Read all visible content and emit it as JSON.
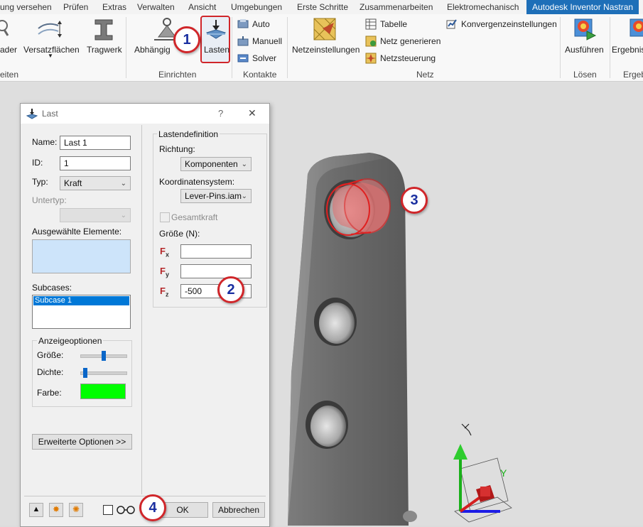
{
  "ribbon_tabs": [
    {
      "label": "ung versehen"
    },
    {
      "label": "Prüfen"
    },
    {
      "label": "Extras"
    },
    {
      "label": "Verwalten"
    },
    {
      "label": "Ansicht"
    },
    {
      "label": "Umgebungen"
    },
    {
      "label": "Erste Schritte"
    },
    {
      "label": "Zusammenarbeiten"
    },
    {
      "label": "Elektromechanisch"
    },
    {
      "label": "Autodesk Inventor Nastran"
    }
  ],
  "ribbon": {
    "btn_ader": "ader",
    "btn_versatz": "Versatzflächen",
    "btn_tragwerk": "Tragwerk",
    "btn_abhaengig": "Abhängig",
    "btn_lasten": "Lasten",
    "btn_auto": "Auto",
    "btn_manuell": "Manuell",
    "btn_solver": "Solver",
    "btn_netzeinst": "Netzeinstellungen",
    "btn_tabelle": "Tabelle",
    "btn_netz_gen": "Netz generieren",
    "btn_netzsteuerung": "Netzsteuerung",
    "btn_konvergenz": "Konvergenzeinstellungen",
    "btn_ausfuehren": "Ausführen",
    "btn_ergebnis": "Ergebnis",
    "grp_eiten": "eiten",
    "grp_einrichten": "Einrichten",
    "grp_kontakte": "Kontakte",
    "grp_netz": "Netz",
    "grp_loesen": "Lösen",
    "grp_ergeb": "Ergeb"
  },
  "dialog": {
    "title": "Last",
    "help": "?",
    "close": "✕",
    "name_label": "Name:",
    "name_value": "Last 1",
    "id_label": "ID:",
    "id_value": "1",
    "typ_label": "Typ:",
    "typ_value": "Kraft",
    "untertyp_label": "Untertyp:",
    "untertyp_value": "",
    "selected_label": "Ausgewählte Elemente:",
    "subcases_label": "Subcases:",
    "subcases": [
      "Subcase 1"
    ],
    "display_group": "Anzeigeoptionen",
    "groesse_label": "Größe:",
    "dichte_label": "Dichte:",
    "farbe_label": "Farbe:",
    "farbe_color": "#00ff00",
    "groesse_level": 0.5,
    "dichte_level": 0.05,
    "advanced_btn": "Erweiterte Optionen >>",
    "lastdef_group": "Lastendefinition",
    "richtung_label": "Richtung:",
    "richtung_value": "Komponenten",
    "koord_label": "Koordinatensystem:",
    "koord_value": "Lever-Pins.iam",
    "gesamtkraft_label": "Gesamtkraft",
    "groesse_n_label": "Größe (N):",
    "fx_symbol": "F",
    "fx_sub": "x",
    "fy_symbol": "F",
    "fy_sub": "y",
    "fz_symbol": "F",
    "fz_sub": "z",
    "fx_value": "",
    "fy_value": "",
    "fz_value": "-500",
    "ok": "OK",
    "cancel": "Abbrechen"
  },
  "callouts": [
    "1",
    "2",
    "3",
    "4"
  ],
  "axis_label_y": "Y",
  "colors": {
    "accent_tab": "#1e6fb8",
    "callout_border": "#d0262a",
    "callout_text": "#1a2fa0",
    "selected_face": "#e06a6a",
    "subcase_selection": "#0078d7"
  },
  "icons": [
    "magnifier-icon",
    "offset-surfaces-icon",
    "beam-icon",
    "constraint-icon",
    "loads-icon",
    "auto-contact-icon",
    "manual-contact-icon",
    "solver-icon",
    "mesh-settings-icon",
    "table-icon",
    "generate-mesh-icon",
    "mesh-control-icon",
    "convergence-icon",
    "run-icon",
    "results-icon",
    "dialog-load-icon",
    "expand-icon",
    "star-icon",
    "star-multi-icon",
    "glasses-icon"
  ]
}
